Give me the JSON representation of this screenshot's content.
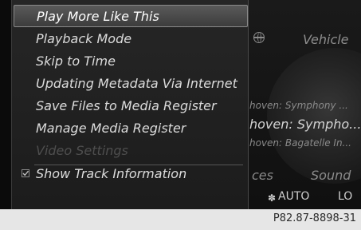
{
  "menu": {
    "items": [
      {
        "label": "Play More Like This",
        "state": "selected"
      },
      {
        "label": "Playback Mode",
        "state": "normal"
      },
      {
        "label": "Skip to Time",
        "state": "normal"
      },
      {
        "label": "Updating Metadata Via Internet",
        "state": "normal"
      },
      {
        "label": "Save Files to Media Register",
        "state": "normal"
      },
      {
        "label": "Manage Media Register",
        "state": "normal"
      },
      {
        "label": "Video Settings",
        "state": "disabled"
      },
      {
        "label": "Show Track Information",
        "state": "checked"
      }
    ]
  },
  "background": {
    "header_label": "Vehicle",
    "header_icon": "globe-icon",
    "tracks": [
      "hoven: Symphony ...",
      "hoven: Sympho...",
      "hoven: Bagatelle In..."
    ],
    "bottom_left": "ces",
    "bottom_right": "Sound",
    "fan_icon": "fan-icon",
    "climate_mode": "AUTO",
    "climate_level": "LO"
  },
  "caption": {
    "code": "P82.87-8898-31"
  },
  "colors": {
    "selected_bg": "#4a4a4a",
    "text": "#dcdcdc",
    "disabled_text": "#4e4e4e",
    "caption_bg": "#e6e6e6"
  }
}
